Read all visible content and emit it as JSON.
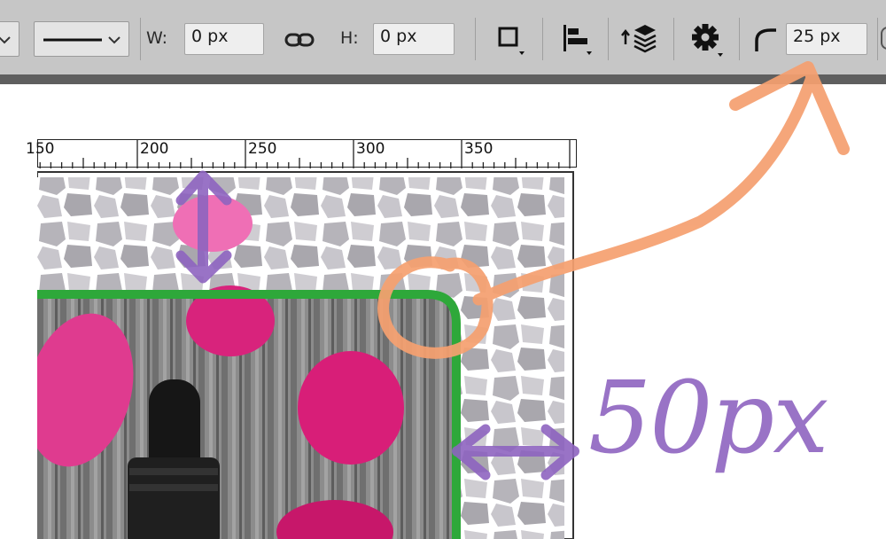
{
  "toolbar": {
    "width_label": "W:",
    "width_value": "0 px",
    "height_label": "H:",
    "height_value": "0 px",
    "radius_value": "25 px"
  },
  "ruler": {
    "ticks": [
      "150",
      "200",
      "250",
      "300",
      "350"
    ]
  },
  "annotations": {
    "distance_label": "50px"
  },
  "colors": {
    "toolbar_bg": "#c6c6c6",
    "frame_stroke": "#2ea83a",
    "annotation_orange": "#f5a070",
    "annotation_purple": "#8e64c0",
    "petal_pink": "#e0287e"
  }
}
